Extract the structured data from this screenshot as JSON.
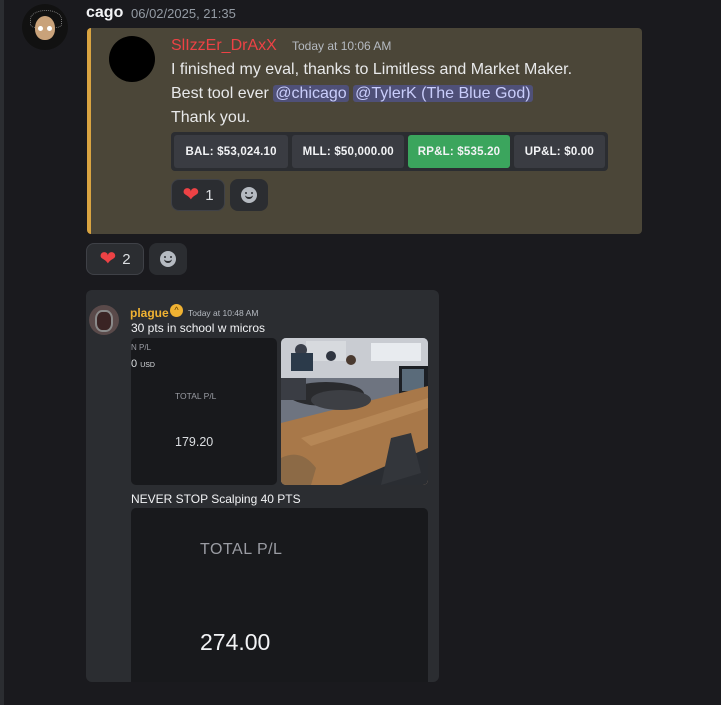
{
  "message": {
    "username": "cago",
    "timestamp": "06/02/2025, 21:35"
  },
  "embed1": {
    "author": "SlIzzEr_DrAxX",
    "time": "Today at 10:06 AM",
    "line1": "I finished my eval, thanks to Limitless and Market Maker.",
    "line2_prefix": "Best tool ever",
    "mention1": "@chicago",
    "mention2": "@TylerK (The Blue God)",
    "line3": "Thank you.",
    "stats": [
      {
        "label": "BAL: $53,024.10"
      },
      {
        "label": "MLL: $50,000.00"
      },
      {
        "label": "RP&L: $535.20",
        "color": "#3ba55d"
      },
      {
        "label": "UP&L: $0.00"
      }
    ],
    "reaction_count": "1"
  },
  "message_reaction_count": "2",
  "embed2": {
    "author": "plague",
    "author_color": "#f0b232",
    "time": "Today at 10:48 AM",
    "text1": "30 pts in school w micros",
    "tile1": {
      "label_cut": "N P/L",
      "value_cut": "0",
      "currency": "USD",
      "total_label": "TOTAL P/L",
      "total_value": "179.20"
    },
    "text2": "NEVER STOP Scalping 40 PTS",
    "tile3": {
      "total_label": "TOTAL P/L",
      "total_value": "274.00"
    }
  },
  "icons": [
    "heart-icon",
    "add-reaction-icon",
    "badge-icon"
  ]
}
